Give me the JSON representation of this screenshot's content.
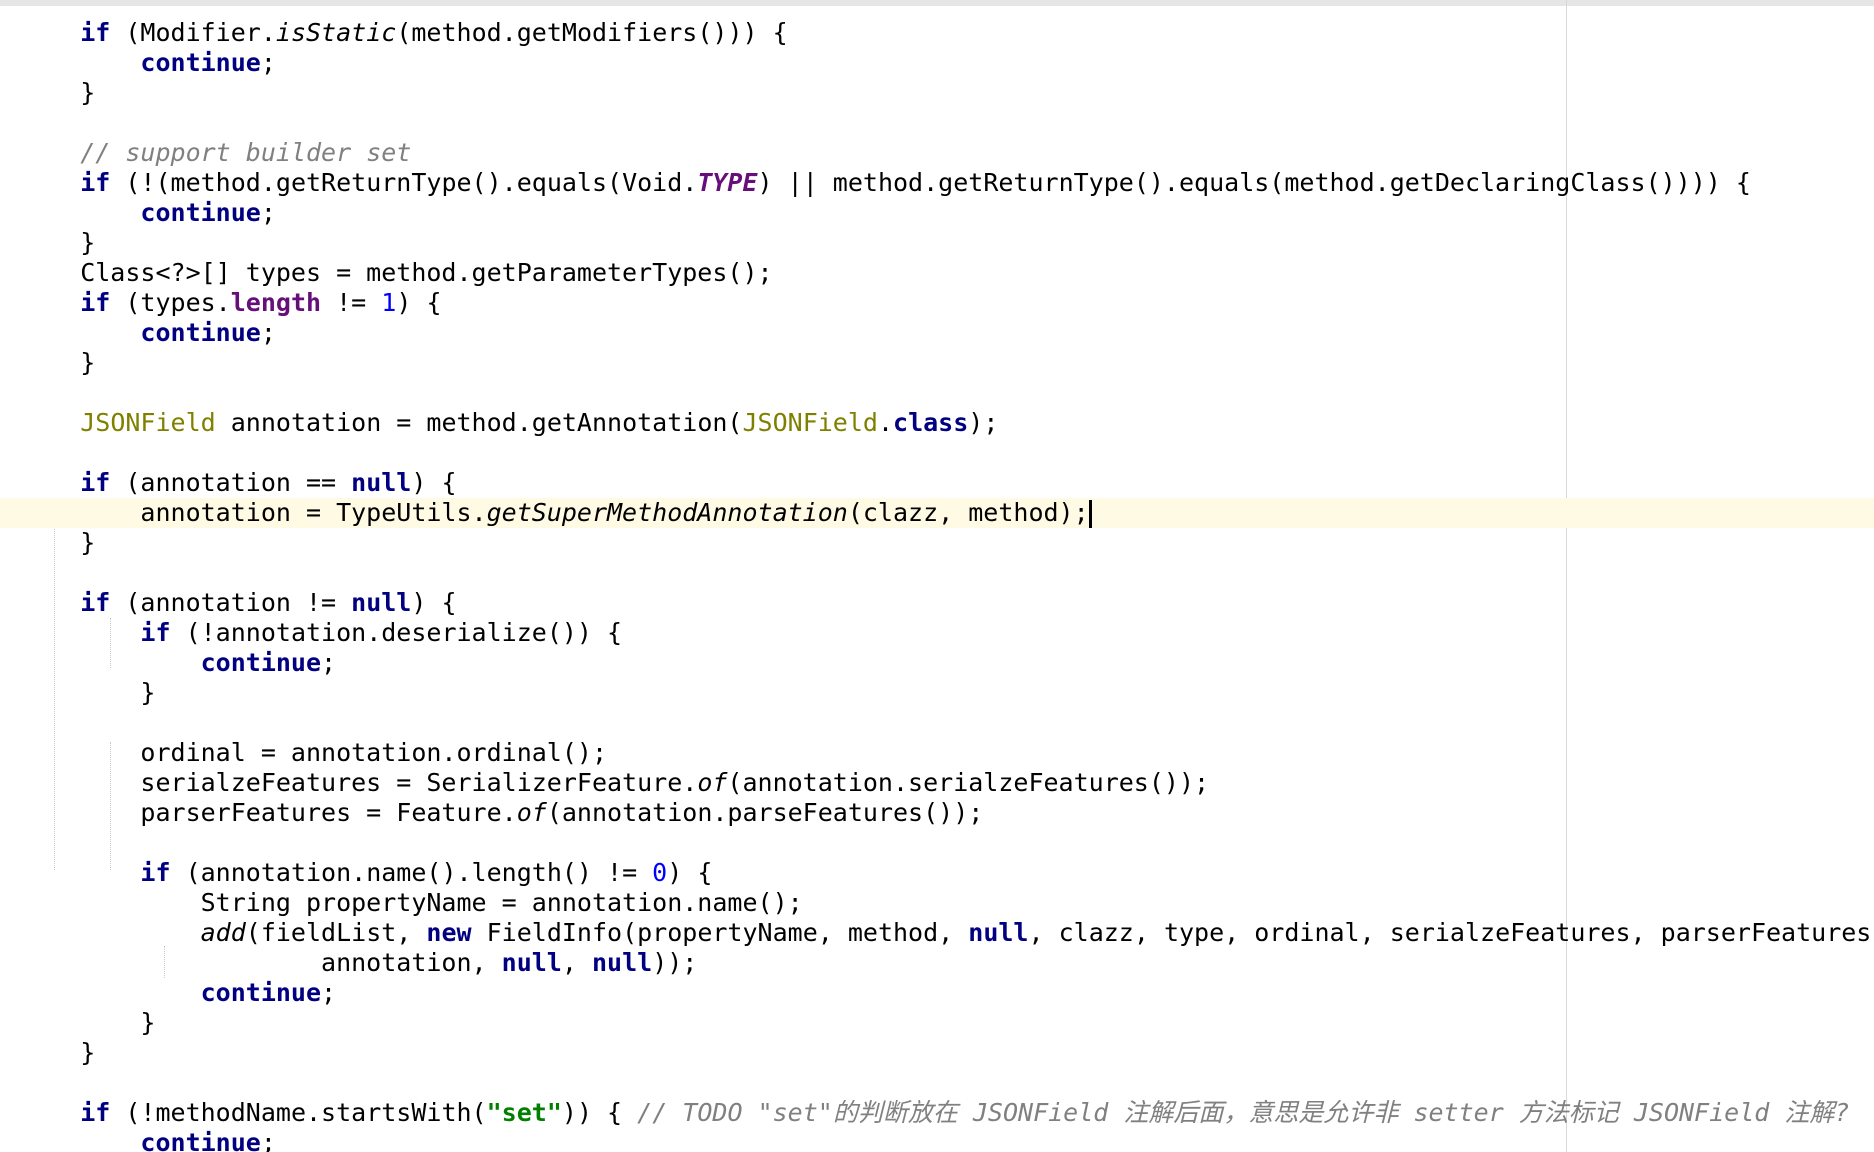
{
  "editor": {
    "colors": {
      "background": "#ffffff",
      "keyword": "#000080",
      "comment": "#808080",
      "annotation": "#808000",
      "field": "#660e7a",
      "number": "#0000ff",
      "string": "#008000",
      "current_line": "#fffae3"
    },
    "current_line_index": 16,
    "lines": [
      [
        {
          "t": "    "
        },
        {
          "t": "if",
          "c": "kw"
        },
        {
          "t": " (Modifier."
        },
        {
          "t": "isStatic",
          "c": "it"
        },
        {
          "t": "(method.getModifiers())) {"
        }
      ],
      [
        {
          "t": "        "
        },
        {
          "t": "continue",
          "c": "kw"
        },
        {
          "t": ";"
        }
      ],
      [
        {
          "t": "    }"
        }
      ],
      [],
      [
        {
          "t": "    "
        },
        {
          "t": "// support builder set",
          "c": "cm"
        }
      ],
      [
        {
          "t": "    "
        },
        {
          "t": "if",
          "c": "kw"
        },
        {
          "t": " (!(method.getReturnType().equals(Void."
        },
        {
          "t": "TYPE",
          "c": "sfi"
        },
        {
          "t": ") || method.getReturnType().equals(method.getDeclaringClass()))) {"
        }
      ],
      [
        {
          "t": "        "
        },
        {
          "t": "continue",
          "c": "kw"
        },
        {
          "t": ";"
        }
      ],
      [
        {
          "t": "    }"
        }
      ],
      [
        {
          "t": "    Class<?>[] types = method.getParameterTypes();"
        }
      ],
      [
        {
          "t": "    "
        },
        {
          "t": "if",
          "c": "kw"
        },
        {
          "t": " (types."
        },
        {
          "t": "length",
          "c": "fld"
        },
        {
          "t": " != "
        },
        {
          "t": "1",
          "c": "num"
        },
        {
          "t": ") {"
        }
      ],
      [
        {
          "t": "        "
        },
        {
          "t": "continue",
          "c": "kw"
        },
        {
          "t": ";"
        }
      ],
      [
        {
          "t": "    }"
        }
      ],
      [],
      [
        {
          "t": "    "
        },
        {
          "t": "JSONField",
          "c": "ann"
        },
        {
          "t": " annotation = method.getAnnotation("
        },
        {
          "t": "JSONField",
          "c": "ann"
        },
        {
          "t": "."
        },
        {
          "t": "class",
          "c": "kw"
        },
        {
          "t": ");"
        }
      ],
      [],
      [
        {
          "t": "    "
        },
        {
          "t": "if",
          "c": "kw"
        },
        {
          "t": " (annotation == "
        },
        {
          "t": "null",
          "c": "kw"
        },
        {
          "t": ") {"
        }
      ],
      [
        {
          "t": "        annotation = TypeUtils."
        },
        {
          "t": "getSuperMethodAnnotation",
          "c": "it"
        },
        {
          "t": "(clazz, method);"
        }
      ],
      [
        {
          "t": "    }"
        }
      ],
      [],
      [
        {
          "t": "    "
        },
        {
          "t": "if",
          "c": "kw"
        },
        {
          "t": " (annotation != "
        },
        {
          "t": "null",
          "c": "kw"
        },
        {
          "t": ") {"
        }
      ],
      [
        {
          "t": "        "
        },
        {
          "t": "if",
          "c": "kw"
        },
        {
          "t": " (!annotation.deserialize()) {"
        }
      ],
      [
        {
          "t": "            "
        },
        {
          "t": "continue",
          "c": "kw"
        },
        {
          "t": ";"
        }
      ],
      [
        {
          "t": "        }"
        }
      ],
      [],
      [
        {
          "t": "        ordinal = annotation.ordinal();"
        }
      ],
      [
        {
          "t": "        serialzeFeatures = SerializerFeature."
        },
        {
          "t": "of",
          "c": "it"
        },
        {
          "t": "(annotation.serialzeFeatures());"
        }
      ],
      [
        {
          "t": "        parserFeatures = Feature."
        },
        {
          "t": "of",
          "c": "it"
        },
        {
          "t": "(annotation.parseFeatures());"
        }
      ],
      [],
      [
        {
          "t": "        "
        },
        {
          "t": "if",
          "c": "kw"
        },
        {
          "t": " (annotation.name().length() != "
        },
        {
          "t": "0",
          "c": "num"
        },
        {
          "t": ") {"
        }
      ],
      [
        {
          "t": "            String propertyName = annotation.name();"
        }
      ],
      [
        {
          "t": "            "
        },
        {
          "t": "add",
          "c": "it"
        },
        {
          "t": "(fieldList, "
        },
        {
          "t": "new",
          "c": "kw"
        },
        {
          "t": " FieldInfo(propertyName, method, "
        },
        {
          "t": "null",
          "c": "kw"
        },
        {
          "t": ", clazz, type, ordinal, serialzeFeatures, parserFeatures,"
        }
      ],
      [
        {
          "t": "                    annotation, "
        },
        {
          "t": "null",
          "c": "kw"
        },
        {
          "t": ", "
        },
        {
          "t": "null",
          "c": "kw"
        },
        {
          "t": "));"
        }
      ],
      [
        {
          "t": "            "
        },
        {
          "t": "continue",
          "c": "kw"
        },
        {
          "t": ";"
        }
      ],
      [
        {
          "t": "        }"
        }
      ],
      [
        {
          "t": "    }"
        }
      ],
      [],
      [
        {
          "t": "    "
        },
        {
          "t": "if",
          "c": "kw"
        },
        {
          "t": " (!methodName.startsWith("
        },
        {
          "t": "\"set\"",
          "c": "str"
        },
        {
          "t": ")) { "
        },
        {
          "t": "// TODO \"set\"的判断放在 JSONField 注解后面，意思是允许非 setter 方法标记 JSONField 注解?",
          "c": "cm"
        }
      ],
      [
        {
          "t": "        "
        },
        {
          "t": "continue",
          "c": "kw"
        },
        {
          "t": ";"
        }
      ]
    ]
  }
}
